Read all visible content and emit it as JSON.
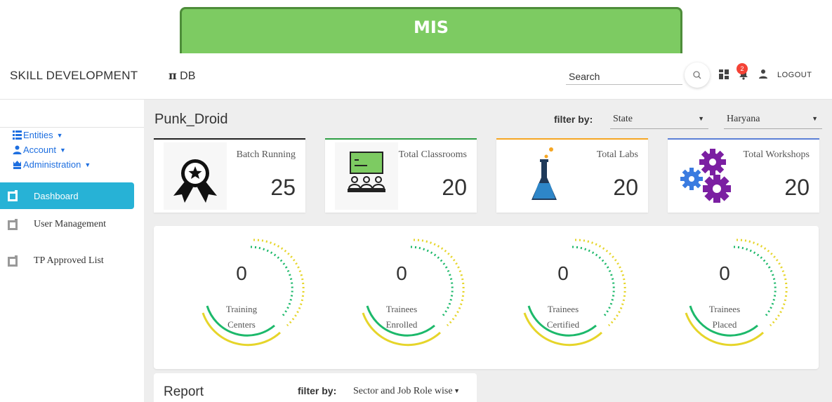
{
  "banner": {
    "title": "MIS"
  },
  "header": {
    "brand": "SKILL DEVELOPMENT",
    "db_symbol": "π",
    "db_label": "DB",
    "search_label": "Search",
    "notification_count": "2",
    "logout_label": "LOGOUT"
  },
  "sidebar": {
    "menus": [
      {
        "label": "Entities",
        "icon": "list-icon"
      },
      {
        "label": "Account",
        "icon": "user-icon"
      },
      {
        "label": "Administration",
        "icon": "admin-icon"
      }
    ],
    "nav": [
      {
        "label": "Dashboard",
        "active": true
      },
      {
        "label": "User Management",
        "active": false
      },
      {
        "label": "TP Approved List",
        "active": false
      }
    ]
  },
  "main": {
    "title": "Punk_Droid",
    "filter_label": "filter by:",
    "filter_type": "State",
    "filter_value": "Haryana",
    "stats": [
      {
        "label": "Batch Running",
        "value": "25",
        "icon": "award-ribbon-icon",
        "accent": "#222222"
      },
      {
        "label": "Total Classrooms",
        "value": "20",
        "icon": "classroom-icon",
        "accent": "#2e9e44"
      },
      {
        "label": "Total Labs",
        "value": "20",
        "icon": "flask-icon",
        "accent": "#f5a623"
      },
      {
        "label": "Total Workshops",
        "value": "20",
        "icon": "gears-icon",
        "accent": "#5b7fd6"
      }
    ],
    "gauges": [
      {
        "value": "0",
        "label_line1": "Training",
        "label_line2": "Centers"
      },
      {
        "value": "0",
        "label_line1": "Trainees",
        "label_line2": "Enrolled"
      },
      {
        "value": "0",
        "label_line1": "Trainees",
        "label_line2": "Certified"
      },
      {
        "value": "0",
        "label_line1": "Trainees",
        "label_line2": "Placed"
      }
    ],
    "report": {
      "title": "Report",
      "filter_label": "filter by:",
      "filter_value": "Sector and Job Role wise"
    }
  },
  "colors": {
    "banner_green": "#7dcb62",
    "active_nav": "#27b2d6",
    "link_blue": "#1e6fe0",
    "gauge_green": "#1db96b",
    "gauge_yellow": "#e6d52a"
  }
}
